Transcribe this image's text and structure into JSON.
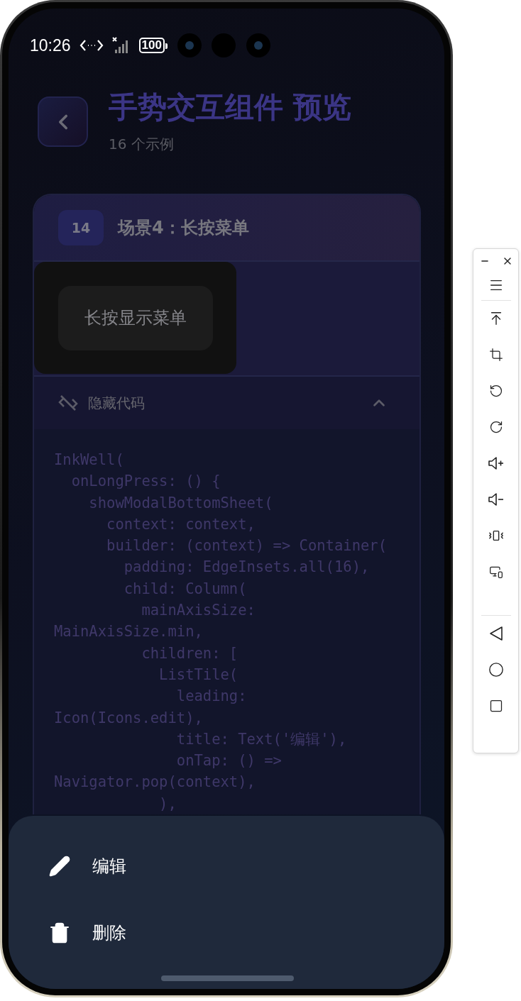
{
  "status_bar": {
    "time": "10:26",
    "battery": "100"
  },
  "header": {
    "title": "手势交互组件 预览",
    "subtitle": "16 个示例"
  },
  "card": {
    "index": "14",
    "title": "场景4：长按菜单",
    "demo_button": "长按显示菜单",
    "code_toggle": {
      "label": "隐藏代码",
      "expanded": true
    },
    "code_lines": [
      "InkWell(",
      "  onLongPress: () {",
      "    showModalBottomSheet(",
      "      context: context,",
      "      builder: (context) => Container(",
      "        padding: EdgeInsets.all(16),",
      "        child: Column(",
      "          mainAxisSize:",
      "MainAxisSize.min,",
      "          children: [",
      "            ListTile(",
      "              leading:",
      "Icon(Icons.edit),",
      "              title: Text('编辑'),",
      "              onTap: () =>",
      "Navigator.pop(context),",
      "            ),"
    ]
  },
  "bottom_sheet": {
    "items": [
      {
        "kind": "edit",
        "label": "编辑"
      },
      {
        "kind": "delete",
        "label": "删除"
      }
    ]
  }
}
